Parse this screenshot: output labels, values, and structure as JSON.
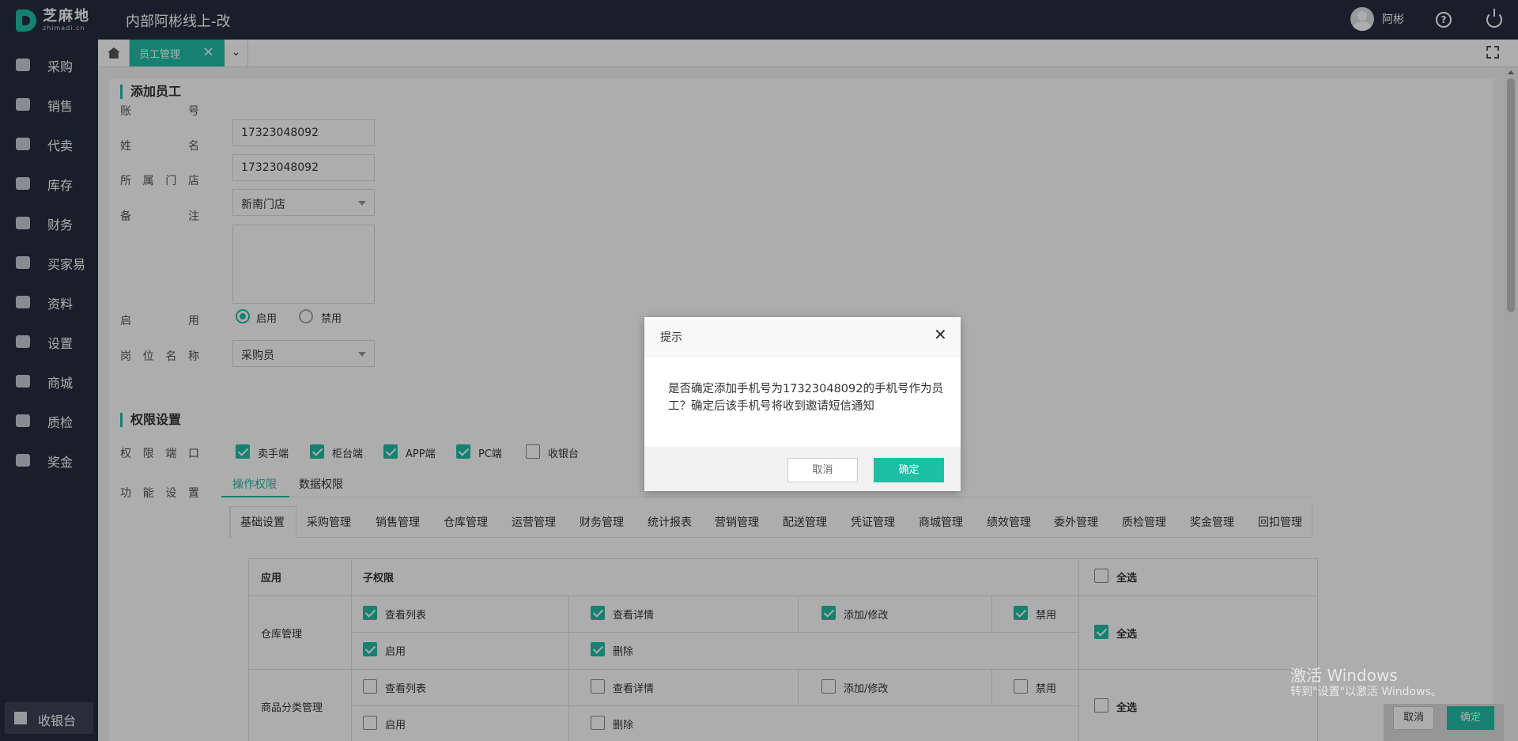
{
  "topbar": {
    "logo_text": "芝麻地",
    "logo_sub": "zhimadi.cn",
    "app_title": "内部阿彬线上-改",
    "user_name": "阿彬",
    "help_icon": "question-circle-icon",
    "power_icon": "power-icon"
  },
  "sidebar": {
    "items": [
      {
        "label": "采购",
        "icon": "basket-icon"
      },
      {
        "label": "销售",
        "icon": "cart-icon"
      },
      {
        "label": "代卖",
        "icon": "tag-icon"
      },
      {
        "label": "库存",
        "icon": "warehouse-icon"
      },
      {
        "label": "财务",
        "icon": "shield-yen-icon"
      },
      {
        "label": "买家易",
        "icon": "store-icon"
      },
      {
        "label": "资料",
        "icon": "printer-icon"
      },
      {
        "label": "设置",
        "icon": "gear-icon"
      },
      {
        "label": "商城",
        "icon": "store-icon"
      },
      {
        "label": "质检",
        "icon": "basket-icon"
      },
      {
        "label": "奖金",
        "icon": "store-icon"
      }
    ],
    "cashier_label": "收银台"
  },
  "tabs": {
    "active_label": "员工管理"
  },
  "form": {
    "section_title": "添加员工",
    "account_label": [
      "账",
      "号"
    ],
    "account_value": "17323048092",
    "name_label": [
      "姓",
      "名"
    ],
    "name_value": "17323048092",
    "store_label": [
      "所",
      "属",
      "门",
      "店"
    ],
    "store_value": "新南门店",
    "remark_label": [
      "备",
      "注"
    ],
    "enable_label": [
      "启",
      "用"
    ],
    "enable_on": "启用",
    "enable_off": "禁用",
    "position_label": [
      "岗",
      "位",
      "名",
      "称"
    ],
    "position_value": "采购员"
  },
  "perm": {
    "section_title": "权限设置",
    "terminal_label": [
      "权",
      "限",
      "端",
      "口"
    ],
    "terminals": [
      {
        "label": "卖手端",
        "checked": true
      },
      {
        "label": "柜台端",
        "checked": true
      },
      {
        "label": "APP端",
        "checked": true
      },
      {
        "label": "PC端",
        "checked": true
      },
      {
        "label": "收银台",
        "checked": false
      }
    ],
    "func_label": [
      "功",
      "能",
      "设",
      "置"
    ],
    "subtabs": [
      "操作权限",
      "数据权限"
    ],
    "modules": [
      "基础设置",
      "采购管理",
      "销售管理",
      "仓库管理",
      "运营管理",
      "财务管理",
      "统计报表",
      "营销管理",
      "配送管理",
      "凭证管理",
      "商城管理",
      "绩效管理",
      "委外管理",
      "质检管理",
      "奖金管理",
      "回扣管理"
    ],
    "table": {
      "col_app": "应用",
      "col_sub": "子权限",
      "col_all": "全选",
      "rows": [
        {
          "app": "仓库管理",
          "perms": [
            {
              "label": "查看列表",
              "checked": true
            },
            {
              "label": "查看详情",
              "checked": true
            },
            {
              "label": "添加/修改",
              "checked": true
            },
            {
              "label": "禁用",
              "checked": true
            },
            {
              "label": "启用",
              "checked": true
            },
            {
              "label": "删除",
              "checked": true
            }
          ],
          "all_checked": true
        },
        {
          "app": "商品分类管理",
          "perms": [
            {
              "label": "查看列表",
              "checked": false
            },
            {
              "label": "查看详情",
              "checked": false
            },
            {
              "label": "添加/修改",
              "checked": false
            },
            {
              "label": "禁用",
              "checked": false
            },
            {
              "label": "启用",
              "checked": false
            },
            {
              "label": "删除",
              "checked": false
            }
          ],
          "all_checked": false
        }
      ]
    }
  },
  "dialog": {
    "title": "提示",
    "message": "是否确定添加手机号为17323048092的手机号作为员工？确定后该手机号将收到邀请短信通知",
    "cancel": "取消",
    "ok": "确定"
  },
  "bottom": {
    "cancel": "取消",
    "ok": "确定"
  },
  "watermark": {
    "line1": "激活 Windows",
    "line2": "转到\"设置\"以激活 Windows。"
  },
  "colors": {
    "accent": "#1fbfa5",
    "sidebar_bg": "#262f3e"
  }
}
